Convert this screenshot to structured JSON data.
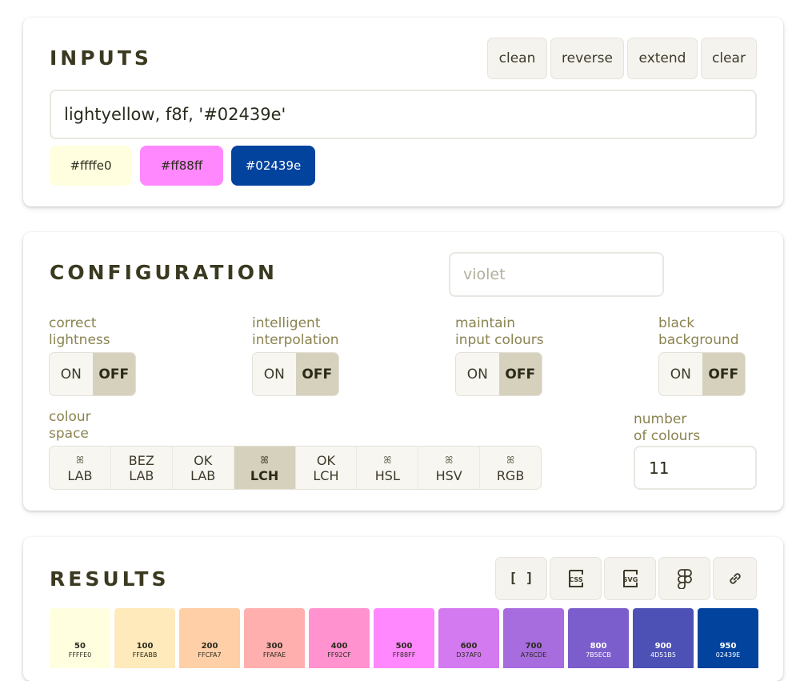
{
  "inputs": {
    "title": "INPUTS",
    "actions": [
      "clean",
      "reverse",
      "extend",
      "clear"
    ],
    "value": "lightyellow, f8f, '#02439e'",
    "chips": [
      {
        "label": "#ffffe0",
        "bg": "#ffffe0",
        "fg": "#2b2b1e"
      },
      {
        "label": "#ff88ff",
        "bg": "#ff88ff",
        "fg": "#2b2b1e"
      },
      {
        "label": "#02439e",
        "bg": "#02439e",
        "fg": "#ffffff"
      }
    ]
  },
  "configuration": {
    "title": "CONFIGURATION",
    "name_placeholder": "violet",
    "toggles": [
      {
        "label1": "correct",
        "label2": "lightness",
        "on": "ON",
        "off": "OFF"
      },
      {
        "label1": "intelligent",
        "label2": "interpolation",
        "on": "ON",
        "off": "OFF"
      },
      {
        "label1": "maintain",
        "label2": "input colours",
        "on": "ON",
        "off": "OFF"
      },
      {
        "label1": "black",
        "label2": "background",
        "on": "ON",
        "off": "OFF"
      }
    ],
    "colour_space": {
      "label1": "colour",
      "label2": "space",
      "options": [
        {
          "top": "ꕤ",
          "bottom": "LAB",
          "icon": true
        },
        {
          "top": "BEZ",
          "bottom": "LAB",
          "icon": false
        },
        {
          "top": "OK",
          "bottom": "LAB",
          "icon": false
        },
        {
          "top": "ꕤ",
          "bottom": "LCH",
          "icon": true,
          "active": true
        },
        {
          "top": "OK",
          "bottom": "LCH",
          "icon": false
        },
        {
          "top": "ꕤ",
          "bottom": "HSL",
          "icon": true
        },
        {
          "top": "ꕤ",
          "bottom": "HSV",
          "icon": true
        },
        {
          "top": "ꕤ",
          "bottom": "RGB",
          "icon": true
        }
      ]
    },
    "count": {
      "label1": "number",
      "label2": "of colours",
      "value": "11"
    }
  },
  "results": {
    "title": "RESULTS",
    "export_icons": [
      "json-array-icon",
      "css-icon",
      "svg-icon",
      "figma-icon",
      "link-icon"
    ],
    "json_glyph": "[ ]",
    "swatches": [
      {
        "step": "50",
        "hex": "FFFFE0",
        "color": "#ffffe0",
        "fg": "#2b2b1e"
      },
      {
        "step": "100",
        "hex": "FFEABB",
        "color": "#ffeabb",
        "fg": "#2b2b1e"
      },
      {
        "step": "200",
        "hex": "FFCFA7",
        "color": "#ffcfa7",
        "fg": "#2b2b1e"
      },
      {
        "step": "300",
        "hex": "FFAFAE",
        "color": "#ffafae",
        "fg": "#2b2b1e"
      },
      {
        "step": "400",
        "hex": "FF92CF",
        "color": "#ff92cf",
        "fg": "#2b2b1e"
      },
      {
        "step": "500",
        "hex": "FF88FF",
        "color": "#ff88ff",
        "fg": "#2b2b1e"
      },
      {
        "step": "600",
        "hex": "D37AF0",
        "color": "#d37af0",
        "fg": "#2b2b1e"
      },
      {
        "step": "700",
        "hex": "A76CDE",
        "color": "#a76cde",
        "fg": "#2b2b1e"
      },
      {
        "step": "800",
        "hex": "7B5ECB",
        "color": "#7b5ecb",
        "fg": "#ffffff"
      },
      {
        "step": "900",
        "hex": "4D51B5",
        "color": "#4d51b5",
        "fg": "#ffffff"
      },
      {
        "step": "950",
        "hex": "02439E",
        "color": "#02439e",
        "fg": "#ffffff"
      }
    ]
  }
}
